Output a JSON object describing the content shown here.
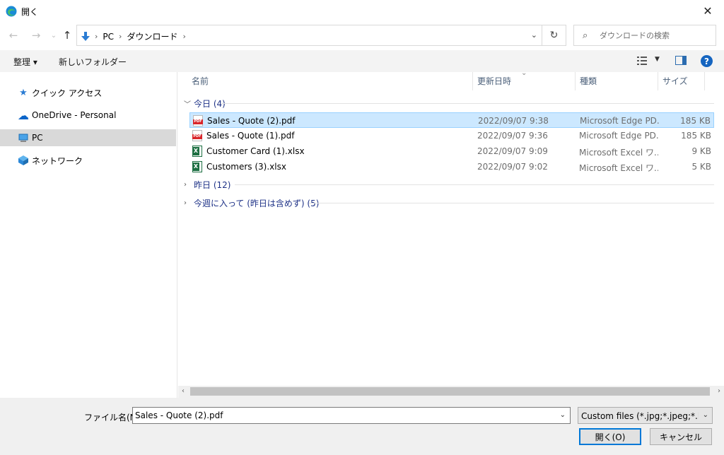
{
  "window": {
    "title": "開く",
    "close_glyph": "✕"
  },
  "nav": {
    "back_glyph": "←",
    "forward_glyph": "→",
    "recent_glyph": "⌄",
    "up_glyph": "↑"
  },
  "address": {
    "crumbs": [
      "PC",
      "ダウンロード"
    ],
    "sep": "›",
    "dropdown_glyph": "⌄",
    "refresh_glyph": "↻"
  },
  "search": {
    "placeholder": "ダウンロードの検索",
    "icon_glyph": "⌕"
  },
  "toolbar": {
    "organize_label": "整理 ▾",
    "new_folder_label": "新しいフォルダー",
    "view_dd": "▼",
    "help_label": "?"
  },
  "sidebar": {
    "items": [
      {
        "label": "クイック アクセス",
        "icon": "star-icon",
        "glyph": "★",
        "color": "#2b7cd3"
      },
      {
        "label": "OneDrive - Personal",
        "icon": "cloud-icon",
        "glyph": "☁",
        "color": "#0a64c8"
      },
      {
        "label": "PC",
        "icon": "computer-icon",
        "glyph": "▭",
        "color": "#2b88d8",
        "selected": true
      },
      {
        "label": "ネットワーク",
        "icon": "network-icon",
        "glyph": "⬢",
        "color": "#2b88d8"
      }
    ]
  },
  "columns": {
    "name": "名前",
    "date": "更新日時",
    "type": "種類",
    "size": "サイズ",
    "sort_glyph": "⌄"
  },
  "groups": [
    {
      "label": "今日 (4)",
      "expanded": true
    },
    {
      "label": "昨日 (12)",
      "expanded": false
    },
    {
      "label": "今週に入って (昨日は含めず) (5)",
      "expanded": false
    }
  ],
  "files": [
    {
      "name": "Sales - Quote (2).pdf",
      "date": "2022/09/07 9:38",
      "type": "Microsoft Edge PD...",
      "size": "185 KB",
      "kind": "pdf",
      "selected": true
    },
    {
      "name": "Sales - Quote (1).pdf",
      "date": "2022/09/07 9:36",
      "type": "Microsoft Edge PD...",
      "size": "185 KB",
      "kind": "pdf"
    },
    {
      "name": "Customer Card (1).xlsx",
      "date": "2022/09/07 9:09",
      "type": "Microsoft Excel ワ...",
      "size": "9 KB",
      "kind": "xlsx"
    },
    {
      "name": "Customers (3).xlsx",
      "date": "2022/09/07 9:02",
      "type": "Microsoft Excel ワ...",
      "size": "5 KB",
      "kind": "xlsx"
    }
  ],
  "hscroll": {
    "left_glyph": "‹",
    "right_glyph": "›"
  },
  "bottom": {
    "filename_label": "ファイル名(N):",
    "filename_value": "Sales - Quote (2).pdf",
    "filter_label": "Custom files (*.jpg;*.jpeg;*.bmp;",
    "dropdown_glyph": "⌄",
    "open_label": "開く(O)",
    "cancel_label": "キャンセル"
  }
}
